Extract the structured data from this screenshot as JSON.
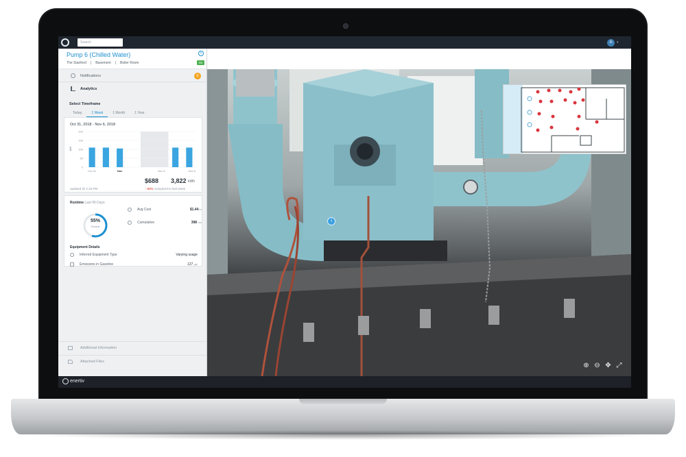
{
  "app": {
    "search_placeholder": "Search",
    "avatar_initial": "A",
    "brand": "enertiv"
  },
  "equipment": {
    "title": "Pump 6 (Chilled Water)",
    "breadcrumb": [
      "The Stanford",
      "Basement",
      "Boiler Room"
    ],
    "status": "On"
  },
  "sections": {
    "notifications_label": "Notifications",
    "notifications_count": "6",
    "analytics_label": "Analytics",
    "additional_info_label": "Additional Information",
    "attached_files_label": "Attached Files"
  },
  "timeframe": {
    "label": "Select Timeframe",
    "tabs": [
      "Today",
      "1 Week",
      "1 Month",
      "1 Year"
    ],
    "active": "1 Week"
  },
  "usage": {
    "date_range": "Oct 31, 2018 - Nov 6, 2018",
    "cost": "$688",
    "kwh": "3,822",
    "kwh_unit": "kWh",
    "updated": "updated @ 2:18 PM",
    "change_pct": "92%",
    "change_text": "compared to last week"
  },
  "chart_data": {
    "type": "bar",
    "y_ticks": [
      "200",
      "150",
      "100",
      "50",
      "0"
    ],
    "ylabel": "kW",
    "x_ticks": [
      "Oct 31",
      "Nov",
      "Nov 6",
      "Nov 6"
    ],
    "ylim": [
      0,
      200
    ],
    "values": [
      110,
      110,
      105,
      0,
      0,
      0,
      110,
      110
    ],
    "highlight_color": "#3aa5e0",
    "shaded_band": [
      4,
      5
    ]
  },
  "runtime": {
    "label": "Runtime",
    "period": "Last 90 Days",
    "percent": "55%",
    "percent_value": 0.55,
    "percent_sub": "Runtime",
    "avg_cost_label": "Avg Cost",
    "avg_cost_value": "$1.44",
    "avg_cost_unit": "/hr",
    "cumulative_label": "Cumulative",
    "cumulative_value": "398",
    "cumulative_unit": "hrs"
  },
  "details": {
    "label": "Equipment Details",
    "inferred_type_label": "Inferred Equipment Type",
    "inferred_type_value": "Varying usage",
    "emissions_label": "Emissions in Gasoline",
    "emissions_value": "127",
    "emissions_unit": "gal"
  },
  "minimap": {
    "zoom_in": "+",
    "zoom_out": "−",
    "pin_color": "#d9363e"
  },
  "viewer_tools": [
    "zoom-in-icon",
    "zoom-out-icon",
    "move-icon",
    "fullscreen-icon"
  ],
  "colors": {
    "accent": "#1c8fd0",
    "status_on": "#4caf50",
    "badge": "#f5a623",
    "pipe_blue": "#8fc3cc"
  }
}
